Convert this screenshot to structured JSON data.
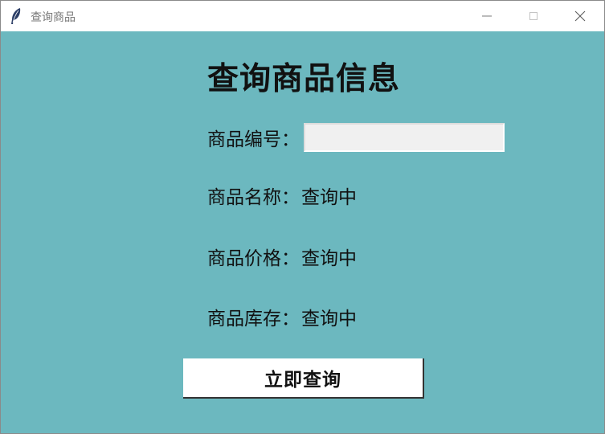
{
  "window": {
    "title": "查询商品",
    "icon": "feather-icon"
  },
  "titlebar_buttons": {
    "minimize": "—",
    "maximize": "☐",
    "close": "✕"
  },
  "colors": {
    "background": "#6cb8bf",
    "input_background": "#f0f0f0",
    "button_background": "#ffffff"
  },
  "form": {
    "heading": "查询商品信息",
    "id_label": "商品编号：",
    "id_value": "",
    "name_label": "商品名称：",
    "name_value": "查询中",
    "price_label": "商品价格：",
    "price_value": "查询中",
    "stock_label": "商品库存：",
    "stock_value": "查询中",
    "query_button": "立即查询"
  }
}
